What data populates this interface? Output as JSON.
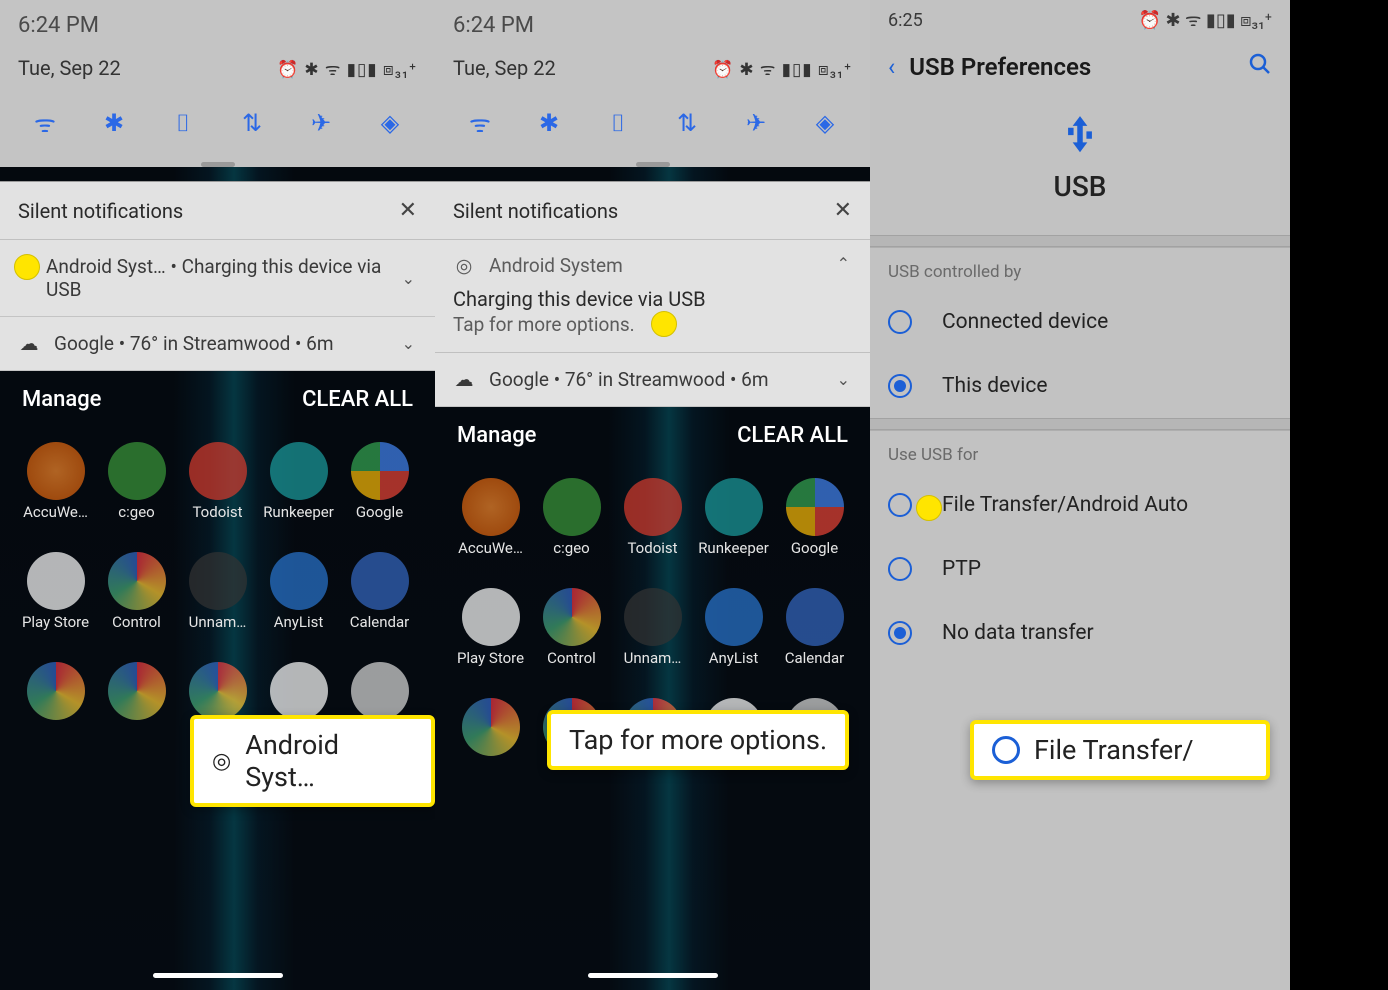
{
  "screen1": {
    "time": "6:24 PM",
    "date": "Tue, Sep 22",
    "status_icons": "⏰ ✱ ᯤ ▮▯▮ ⧈₃₁⁺",
    "silent_header": "Silent notifications",
    "notif1": "Android Syst…  • Charging this device via USB",
    "notif2": "Google • 76° in Streamwood • 6m",
    "manage": "Manage",
    "clear": "CLEAR ALL",
    "apps": [
      "AccuWe…",
      "c:geo",
      "Todoist",
      "Runkeep­er",
      "Google",
      "Play Store",
      "Control",
      "Unnam…",
      "AnyList",
      "Calendar",
      "",
      "",
      "",
      "",
      ""
    ],
    "callout": "Android Syst…"
  },
  "screen2": {
    "time": "6:24 PM",
    "date": "Tue, Sep 22",
    "status_icons": "⏰ ✱ ᯤ ▮▯▮ ⧈₃₁⁺",
    "silent_header": "Silent notifications",
    "exp_head": "Android System",
    "exp_title": "Charging this device via USB",
    "exp_sub": "Tap for more options.",
    "notif2": "Google • 76° in Streamwood • 6m",
    "manage": "Manage",
    "clear": "CLEAR ALL",
    "apps": [
      "AccuWe…",
      "c:geo",
      "Todoist",
      "Runkeep­er",
      "Google",
      "Play Store",
      "Control",
      "Unnam…",
      "AnyList",
      "Calendar",
      "",
      "",
      "",
      "",
      ""
    ],
    "callout": "Tap for more options."
  },
  "screen3": {
    "time": "6:25",
    "status_icons": "⏰ ✱ ᯤ ▮▯▮ ⧈₃₁⁺",
    "title": "USB Preferences",
    "hero": "USB",
    "section1": "USB controlled by",
    "opt_connected": "Connected device",
    "opt_this": "This device",
    "section2": "Use USB for",
    "opt_file": "File Transfer/Android Auto",
    "opt_ptp": "PTP",
    "opt_none": "No data transfer",
    "callout": "File Transfer/"
  }
}
